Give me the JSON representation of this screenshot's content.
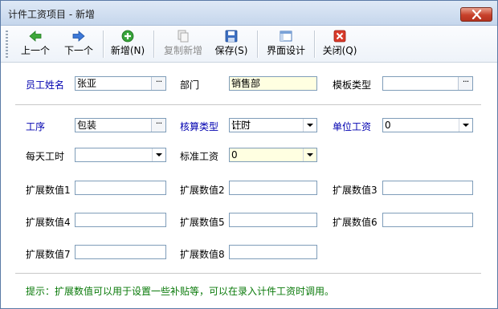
{
  "window": {
    "title": "计件工资项目 - 新增"
  },
  "toolbar": {
    "prev": "上一个",
    "next": "下一个",
    "add": "新增(N)",
    "copy_add": "复制新增",
    "save": "保存(S)",
    "layout": "界面设计",
    "close": "关闭(Q)"
  },
  "form": {
    "employee_name": {
      "label": "员工姓名",
      "value": "张亚"
    },
    "department": {
      "label": "部门",
      "value": "销售部"
    },
    "template_type": {
      "label": "模板类型",
      "value": ""
    },
    "process": {
      "label": "工序",
      "value": "包装"
    },
    "calc_type": {
      "label": "核算类型",
      "value": "计时"
    },
    "unit_wage": {
      "label": "单位工资",
      "value": "0"
    },
    "daily_hours": {
      "label": "每天工时",
      "value": ""
    },
    "standard_wage": {
      "label": "标准工资",
      "value": "0"
    },
    "ext1": {
      "label": "扩展数值1",
      "value": ""
    },
    "ext2": {
      "label": "扩展数值2",
      "value": ""
    },
    "ext3": {
      "label": "扩展数值3",
      "value": ""
    },
    "ext4": {
      "label": "扩展数值4",
      "value": ""
    },
    "ext5": {
      "label": "扩展数值5",
      "value": ""
    },
    "ext6": {
      "label": "扩展数值6",
      "value": ""
    },
    "ext7": {
      "label": "扩展数值7",
      "value": ""
    },
    "ext8": {
      "label": "扩展数值8",
      "value": ""
    }
  },
  "hint": "提示：扩展数值可以用于设置一些补贴等，可以在录入计件工资时调用。",
  "colors": {
    "blue_label": "#0000b0",
    "hint_green": "#0a7a0a",
    "required_yellow": "#ffffe1"
  }
}
